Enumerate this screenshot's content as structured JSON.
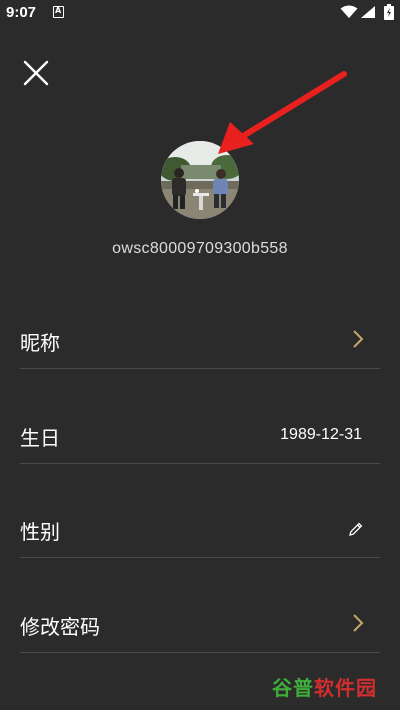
{
  "status_bar": {
    "time": "9:07"
  },
  "profile": {
    "username": "owsc80009709300b558"
  },
  "settings": {
    "nickname_label": "昵称",
    "birthday_label": "生日",
    "birthday_value": "1989-12-31",
    "gender_label": "性别",
    "change_password_label": "修改密码"
  },
  "watermark": {
    "part1": "谷普",
    "part2": "软件园"
  },
  "colors": {
    "background": "#2b2b2b",
    "accent_chevron": "#c9a56a",
    "annotation_arrow": "#e8211f",
    "divider": "#4a4a4a"
  },
  "icons": {
    "close": "close-icon",
    "chevron": "chevron-right-icon",
    "edit": "pencil-icon",
    "wifi": "wifi-icon",
    "signal": "signal-icon",
    "battery": "battery-icon"
  }
}
